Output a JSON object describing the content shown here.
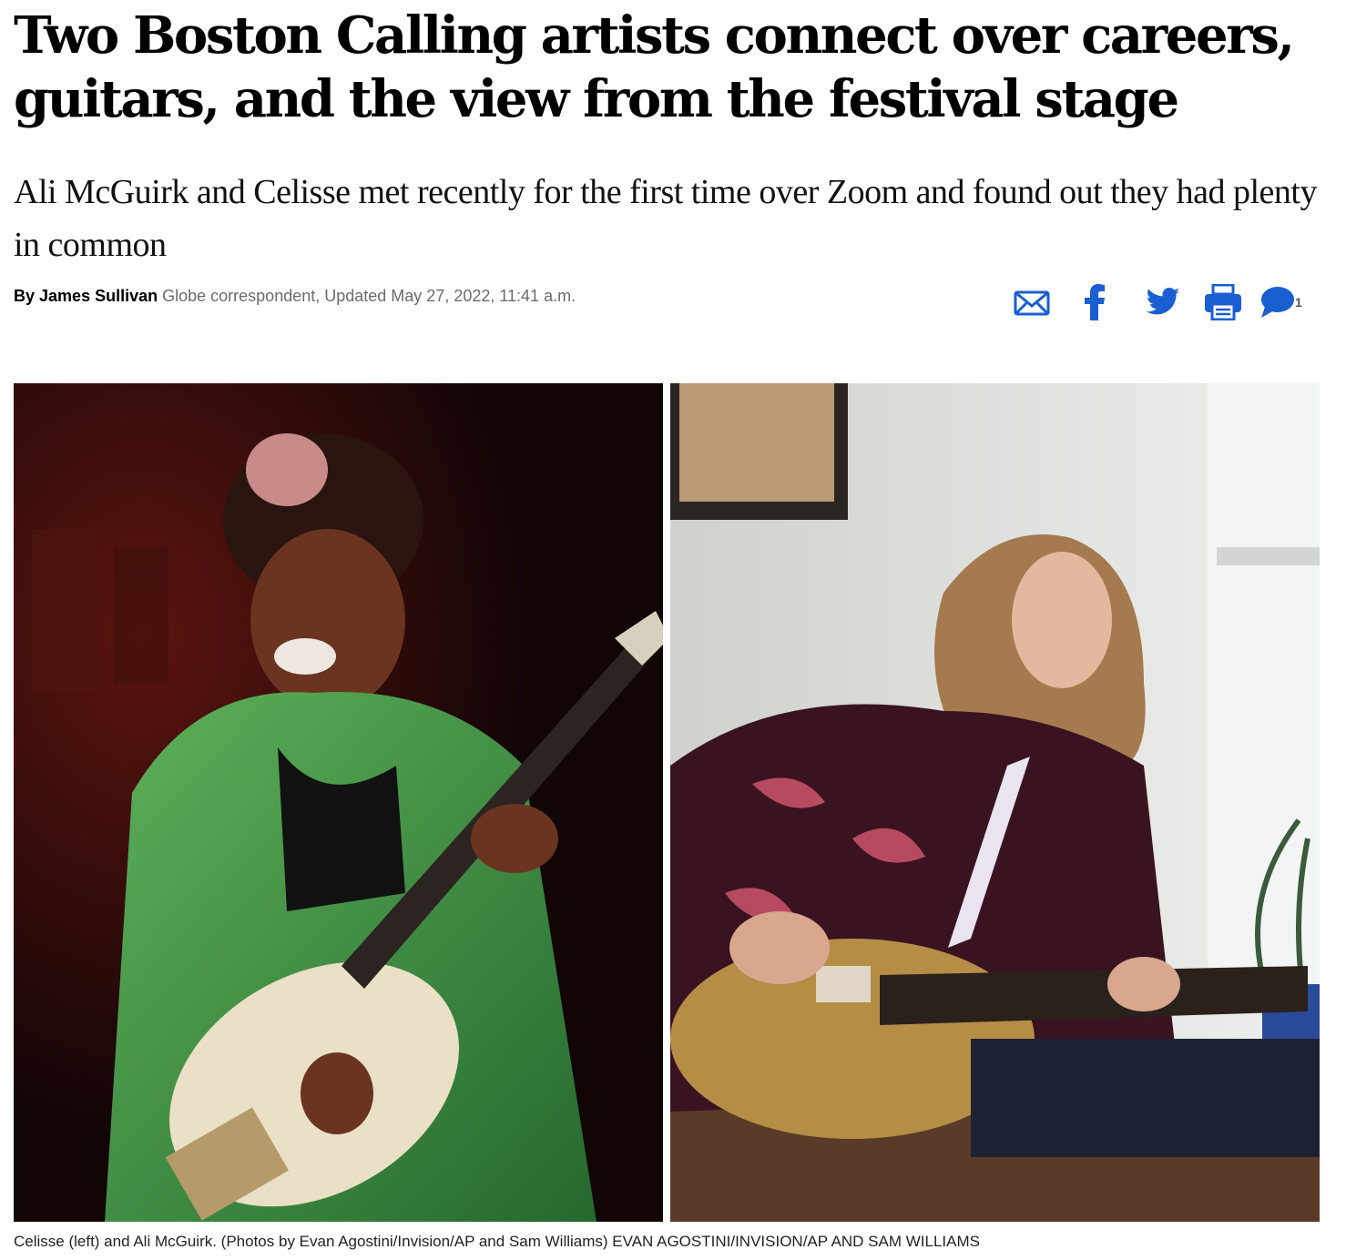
{
  "article": {
    "headline": "Two Boston Calling artists connect over careers, guitars, and the view from the festival stage",
    "subhead": "Ali McGuirk and Celisse met recently for the first time over Zoom and found out they had plenty in common",
    "byline": {
      "prefix": "By",
      "author": "James Sullivan",
      "meta": "Globe correspondent, Updated May 27, 2022, 11:41 a.m."
    },
    "share": {
      "accent_color": "#1a5fd1",
      "buttons": [
        "envelope-icon",
        "facebook-icon",
        "twitter-icon",
        "print-icon",
        "comment-icon"
      ],
      "comment_count": "1"
    },
    "photos": {
      "left_alt": "Celisse",
      "right_alt": "Ali McGuirk"
    },
    "caption": {
      "text": "Celisse (left) and Ali McGuirk. (Photos by Evan Agostini/Invision/AP and Sam Williams)",
      "credit": "EVAN AGOSTINI/INVISION/AP AND SAM WILLIAMS"
    }
  }
}
